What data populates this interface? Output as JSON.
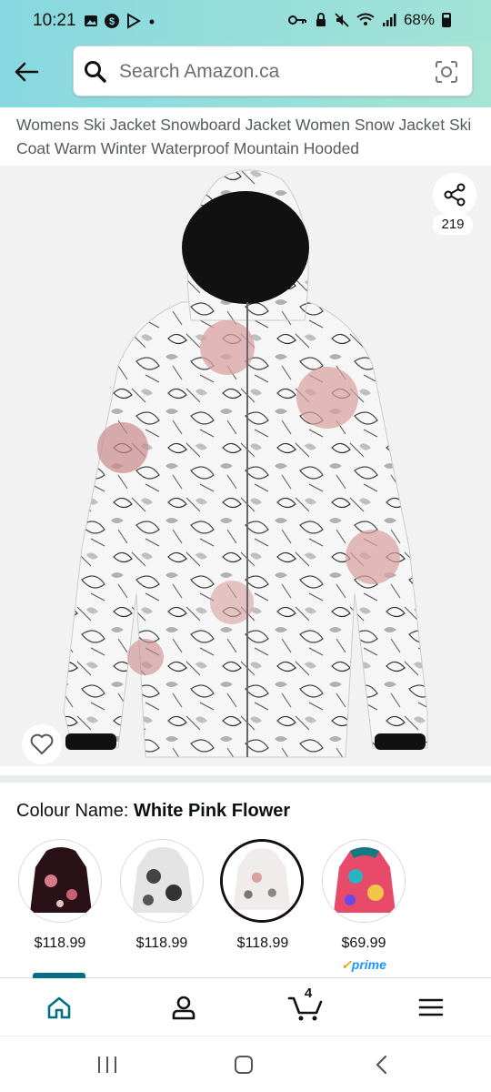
{
  "status_bar": {
    "time": "10:21",
    "battery": "68%",
    "icons_left": [
      "gallery-icon",
      "s-icon",
      "play-store-icon",
      "dot-icon"
    ],
    "icons_right": [
      "key-icon",
      "lock-icon",
      "mute-icon",
      "wifi-icon",
      "signal-icon",
      "battery-icon"
    ]
  },
  "search": {
    "placeholder": "Search Amazon.ca"
  },
  "product": {
    "title": "Womens Ski Jacket Snowboard Jacket Women Snow Jacket Ski Coat Warm Winter Waterproof Mountain Hooded",
    "share_count": "219",
    "colour_label": "Colour Name:",
    "colour_value": "White Pink Flower"
  },
  "swatches": [
    {
      "price": "$118.99",
      "prime": "",
      "selected": false,
      "color": "#3a1a22"
    },
    {
      "price": "$118.99",
      "prime": "",
      "selected": false,
      "color": "#e8e8e8"
    },
    {
      "price": "$118.99",
      "prime": "",
      "selected": true,
      "color": "#f4f0f0"
    },
    {
      "price": "$69.99",
      "prime": "prime",
      "selected": false,
      "color": "#e84a6a"
    }
  ],
  "bottom_nav": {
    "cart_count": "4",
    "items": [
      "home-icon",
      "account-icon",
      "cart-icon",
      "menu-icon"
    ]
  },
  "colors": {
    "accent_teal": "#007185",
    "prime_blue": "#1a98ff",
    "header_gradient_start": "#87d8e0",
    "header_gradient_end": "#a6e4d4"
  }
}
